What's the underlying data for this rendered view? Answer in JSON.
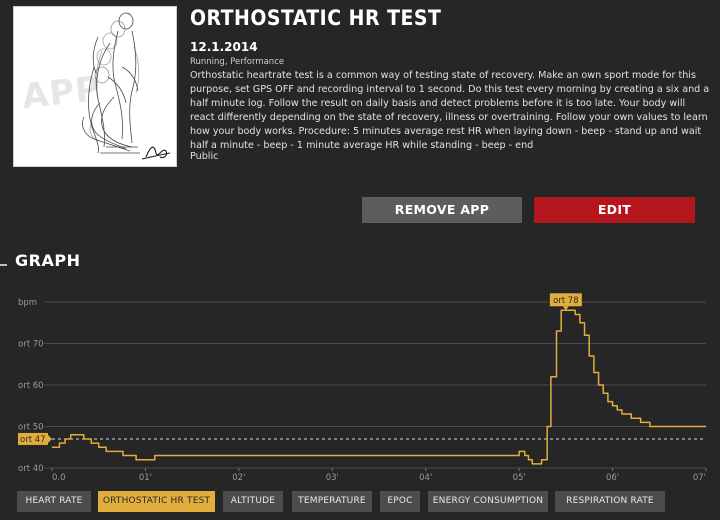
{
  "app": {
    "title": "ORTHOSTATIC HR TEST",
    "date": "12.1.2014",
    "categories": "Running, Performance",
    "description": "Orthostatic heartrate test is a common way of testing state of recovery. Make an own sport mode for this purpose, set GPS OFF and recording interval to 1 second. Do this test every morning by creating a six and a half minute log. Follow the result on daily basis and detect problems before it is too late. Your body will react differently depending on the state of recovery, illness or overtraining. Follow your own values to learn how your body works. Procedure: 5 minutes average rest HR when laying down - beep - stand up and wait half a minute - beep - 1 minute average HR while standing - beep - end",
    "visibility": "Public",
    "thumbnail_watermark": "APP"
  },
  "buttons": {
    "remove": "REMOVE APP",
    "edit": "EDIT"
  },
  "graph": {
    "section_title": "GRAPH"
  },
  "tabs": [
    {
      "label": "HEART RATE",
      "active": false
    },
    {
      "label": "ORTHOSTATIC HR TEST",
      "active": true
    },
    {
      "label": "ALTITUDE",
      "active": false
    },
    {
      "label": "TEMPERATURE",
      "active": false
    },
    {
      "label": "EPOC",
      "active": false
    },
    {
      "label": "ENERGY CONSUMPTION",
      "active": false
    },
    {
      "label": "RESPIRATION RATE",
      "active": false
    }
  ],
  "colors": {
    "background": "#262626",
    "line": "#e1ad3c",
    "edit_button": "#b3161c",
    "remove_button": "#5d5d5d",
    "grid": "#4a4a4a"
  },
  "chart_data": {
    "type": "line",
    "ylabel": "bpm",
    "y_tick_labels": [
      "ort 40",
      "ort 50",
      "ort 60",
      "ort 70",
      "bpm"
    ],
    "y_ticks": [
      40,
      50,
      60,
      70,
      80
    ],
    "ylim": [
      40,
      80
    ],
    "x_tick_labels": [
      "0.0",
      "01'",
      "02'",
      "03'",
      "04'",
      "05'",
      "06'",
      "07'"
    ],
    "x_ticks": [
      0,
      1,
      2,
      3,
      4,
      5,
      6,
      7
    ],
    "xlim": [
      0,
      7
    ],
    "series": [
      {
        "x": [
          0,
          0.08,
          0.14,
          0.2,
          0.26,
          0.34,
          0.42,
          0.5,
          0.58,
          0.66,
          0.76,
          0.9,
          1.1,
          1.5,
          2,
          2.5,
          3,
          3.5,
          4,
          4.5,
          4.9,
          5.0,
          5.06,
          5.1,
          5.14,
          5.18,
          5.24,
          5.3,
          5.34,
          5.4,
          5.45,
          5.5,
          5.55,
          5.6,
          5.65,
          5.7,
          5.75,
          5.8,
          5.85,
          5.9,
          5.95,
          6.0,
          6.05,
          6.1,
          6.15,
          6.2,
          6.25,
          6.3,
          6.35,
          6.4,
          6.5,
          6.7,
          6.9,
          7.0
        ],
        "y": [
          45,
          46,
          47,
          48,
          48,
          47,
          46,
          45,
          44,
          44,
          43,
          42,
          43,
          43,
          43,
          43,
          43,
          43,
          43,
          43,
          43,
          44,
          43,
          42,
          41,
          41,
          42,
          50,
          62,
          73,
          78,
          78,
          78,
          77,
          75,
          72,
          67,
          63,
          60,
          58,
          56,
          55,
          54,
          53,
          53,
          52,
          52,
          51,
          51,
          50,
          50,
          50,
          50,
          50
        ]
      }
    ],
    "average_line": {
      "y": 47,
      "label": "ort 47"
    },
    "peak_marker": {
      "x": 5.5,
      "y": 78,
      "label": "ort 78"
    },
    "grid": true
  }
}
